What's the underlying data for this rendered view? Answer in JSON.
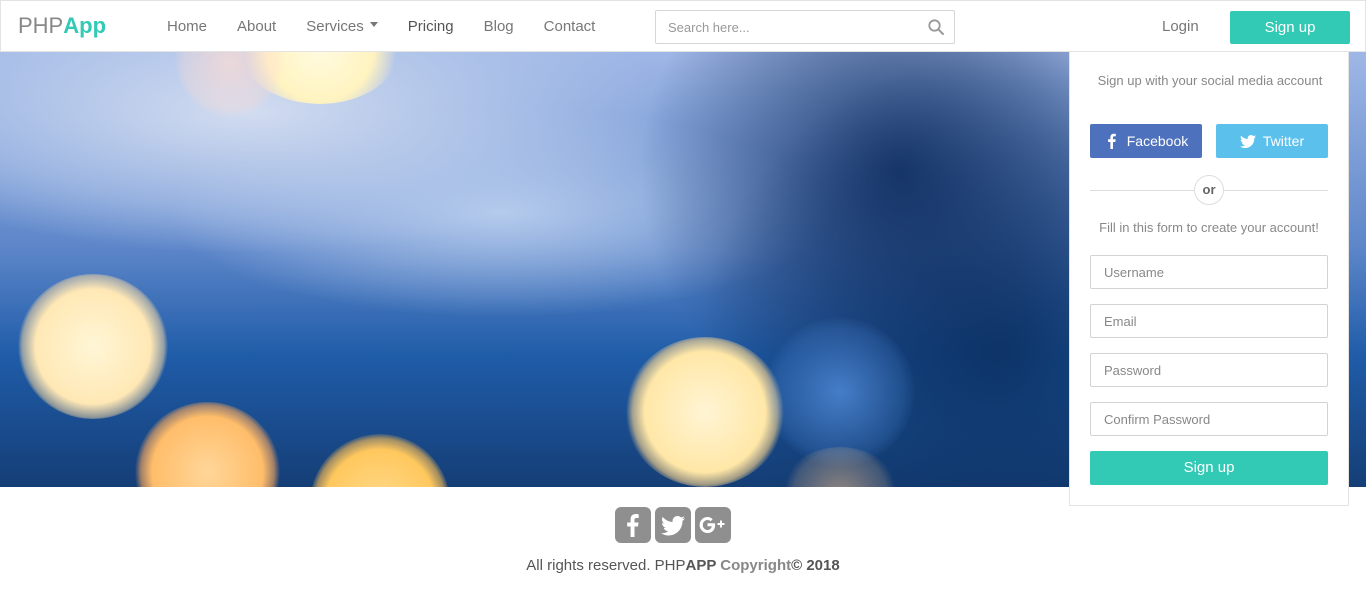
{
  "brand": {
    "part1": "PHP",
    "part2": "App"
  },
  "nav": {
    "items": [
      {
        "label": "Home"
      },
      {
        "label": "About"
      },
      {
        "label": "Services"
      },
      {
        "label": "Pricing"
      },
      {
        "label": "Blog"
      },
      {
        "label": "Contact"
      }
    ]
  },
  "search": {
    "placeholder": "Search here...",
    "icon": "search-icon"
  },
  "header": {
    "login_label": "Login",
    "signup_label": "Sign up"
  },
  "signup_panel": {
    "title": "Sign up with your social media account",
    "facebook_label": "Facebook",
    "twitter_label": "Twitter",
    "or_label": "or",
    "subtitle": "Fill in this form to create your account!",
    "username_placeholder": "Username",
    "email_placeholder": "Email",
    "password_placeholder": "Password",
    "confirm_password_placeholder": "Confirm Password",
    "submit_label": "Sign up"
  },
  "footer": {
    "social_icons": [
      "facebook-icon",
      "twitter-icon",
      "google-plus-icon"
    ],
    "text_prefix": "All rights reserved. PHP",
    "text_brand": "APP",
    "text_copyright": " Copyright",
    "text_year": "© 2018"
  },
  "colors": {
    "accent": "#32c9b5",
    "facebook": "#4e71bd",
    "twitter": "#5bc0ec",
    "social_icon_bg": "#8f8f8f"
  }
}
